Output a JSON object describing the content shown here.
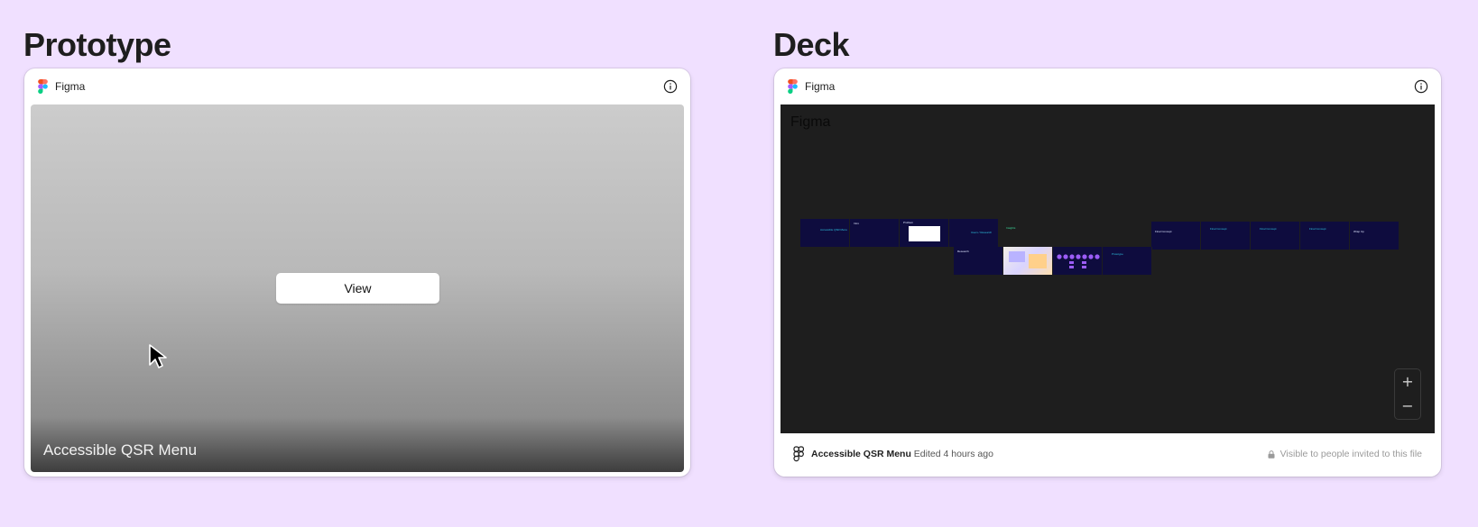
{
  "prototype": {
    "section_title": "Prototype",
    "brand": "Figma",
    "view_label": "View",
    "file_title": "Accessible QSR Menu"
  },
  "deck": {
    "section_title": "Deck",
    "brand": "Figma",
    "canvas_label": "Figma",
    "file_name": "Accessible QSR Menu",
    "edited": "Edited 4 hours ago",
    "visibility": "Visible to people invited to this file",
    "zoom_in": "+",
    "zoom_out": "−",
    "slides": [
      {
        "title": "Accessible QSR Menu",
        "sub": ""
      },
      {
        "title": "Intro",
        "sub": ""
      },
      {
        "title": "Problem",
        "sub": ""
      },
      {
        "title": "Users / Research",
        "sub": ""
      },
      {
        "title": "Insights",
        "sub": ""
      },
      {
        "title": "Final Concept",
        "sub": ""
      },
      {
        "title": "Final Concept",
        "sub": ""
      },
      {
        "title": "Final Concept",
        "sub": ""
      },
      {
        "title": "Final Concept",
        "sub": ""
      },
      {
        "title": "Wrap Up",
        "sub": ""
      },
      {
        "title": "Research",
        "sub": ""
      },
      {
        "title": "Process",
        "sub": ""
      },
      {
        "title": "Flows",
        "sub": ""
      },
      {
        "title": "Prototype",
        "sub": ""
      }
    ]
  },
  "colors": {
    "background": "#f0e0ff",
    "canvas": "#1e1e1e",
    "slide": "#0e0c3e",
    "accent_cyan": "#2ec4e0",
    "accent_purple": "#9b5cf6"
  }
}
